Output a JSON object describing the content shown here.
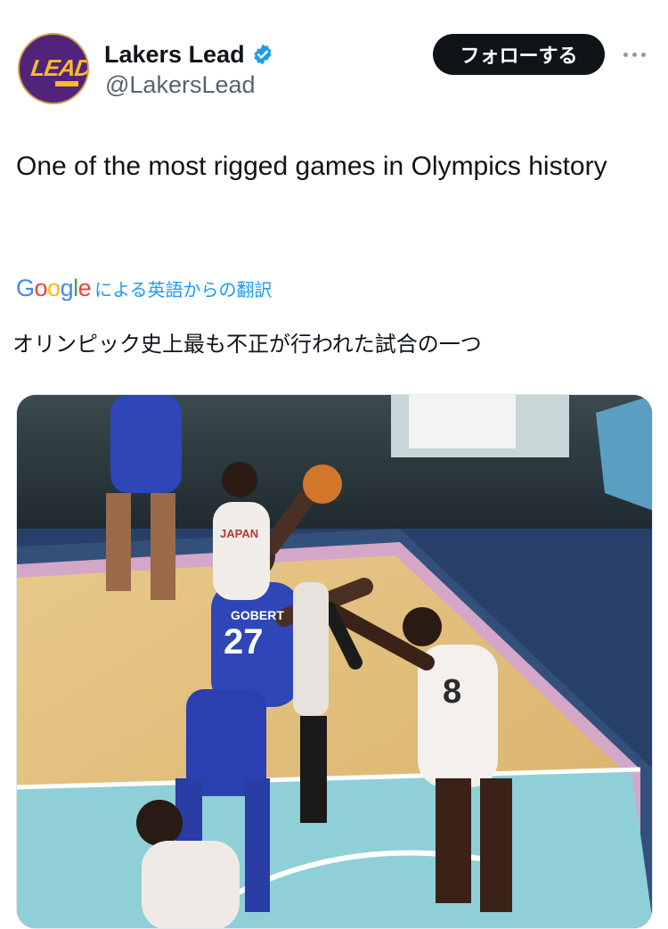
{
  "author": {
    "name": "Lakers Lead",
    "handle": "@LakersLead",
    "verified": true,
    "avatar_text": "LEAD"
  },
  "follow_button": {
    "label": "フォローする"
  },
  "more_icon": "more-horizontal-icon",
  "tweet": {
    "text": "One of the most rigged games in Olympics history"
  },
  "translation": {
    "provider": "Google",
    "link_label": "による英語からの翻訳",
    "text": "オリンピック史上最も不正が行われた試合の一つ"
  },
  "media": {
    "type": "photo",
    "jersey_numbers": [
      "27",
      "8"
    ],
    "jersey_name": "GOBERT",
    "team_text": "JAPAN"
  },
  "colors": {
    "follow_bg": "#0f1419",
    "link_blue": "#1d9bf0",
    "verified_blue": "#1d9bf0",
    "avatar_purple": "#51237a",
    "avatar_gold": "#fdb927"
  }
}
